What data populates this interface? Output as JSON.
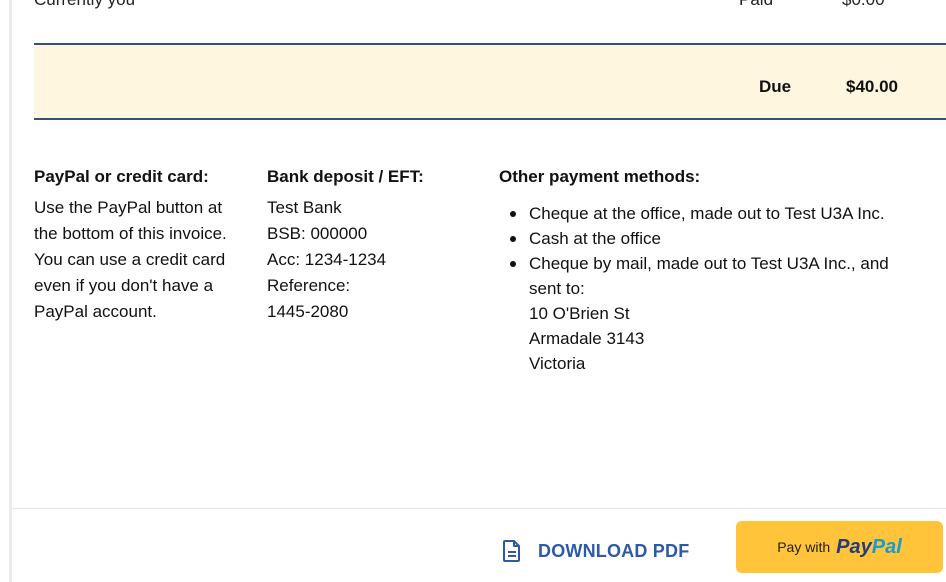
{
  "invoice": {
    "top_left_text": "Currently you",
    "paid_label": "Paid",
    "paid_value": "$0.00",
    "due_label": "Due",
    "due_value": "$40.00"
  },
  "payment_methods": {
    "paypal": {
      "heading": "PayPal or credit card:",
      "body": "Use the PayPal button at the bottom of this invoice. You can use a credit card even if you don't have a PayPal account."
    },
    "bank": {
      "heading": "Bank deposit / EFT:",
      "lines": [
        "Test Bank",
        "BSB: 000000",
        "Acc: 1234-1234",
        "Reference:",
        "1445-2080"
      ]
    },
    "other": {
      "heading": "Other payment methods:",
      "items": [
        [
          "Cheque at the office, made out to Test U3A Inc."
        ],
        [
          "Cash at the office"
        ],
        [
          "Cheque by mail, made out to Test U3A Inc., and sent to:",
          "10 O'Brien St",
          "Armadale 3143",
          "Victoria"
        ]
      ]
    }
  },
  "footer": {
    "download_label": "DOWNLOAD PDF",
    "paypal_prefix": "Pay with",
    "paypal_brand_1": "Pay",
    "paypal_brand_2": "Pal"
  },
  "colors": {
    "rule": "#2f4f86",
    "due_background": "#fff6df",
    "link": "#2d5aa6",
    "paypal_button": "#ffc439"
  },
  "icons": {
    "download": "document-icon"
  }
}
